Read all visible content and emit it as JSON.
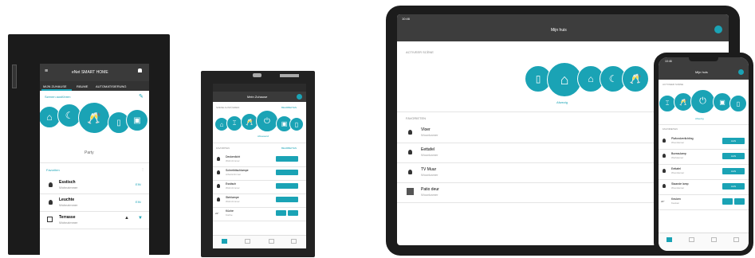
{
  "device1": {
    "app_title": "eNet SMART HOME",
    "tabs": [
      "MIJN ZUHAUSE",
      "RÄUME",
      "AUTOMATISIERUNG"
    ],
    "section_label": "Szenen ausführen",
    "active_scene": "Party",
    "favorites_label": "Favoriten",
    "items": [
      {
        "name": "Esstisch",
        "room": "Wohnzimmer",
        "action": "EIN"
      },
      {
        "name": "Leuchte",
        "room": "Wohnzimmer",
        "action": "EIN"
      },
      {
        "name": "Terrasse",
        "room": "Wohnzimmer",
        "action": ""
      }
    ]
  },
  "device2": {
    "app_title": "Mein Zuhause",
    "section_label": "SZENE AUSFÜHREN",
    "edit_label": "BEARBEITEN",
    "active_scene": "Abwesend",
    "favorites_label": "FAVORITEN",
    "items": [
      {
        "name": "Deckenlicht",
        "room": "Wohnzimmer"
      },
      {
        "name": "Schreibtischlampe",
        "room": "Arbeitszimmer"
      },
      {
        "name": "Esstisch",
        "room": "Wohnzimmer"
      },
      {
        "name": "Stehlampe",
        "room": "Wohnzimmer"
      },
      {
        "name": "Küche",
        "room": "Küche"
      }
    ]
  },
  "tablet": {
    "time": "10:46",
    "app_title": "Mijn huis",
    "section_label": "ACTIVEER SCÈNE",
    "active_scene": "Afwezig",
    "favorites_label": "FAVORIETEN",
    "items": [
      {
        "name": "Vloer",
        "room": "Woonkamer"
      },
      {
        "name": "Eettafel",
        "room": "Woonkamer"
      },
      {
        "name": "TV Muur",
        "room": "Woonkamer"
      },
      {
        "name": "Patio deur",
        "room": "Woonkamer"
      }
    ]
  },
  "phone": {
    "time": "10:46",
    "app_title": "Mijn huis",
    "section_label": "ACTIVEER SCÈNE",
    "active_scene": "Afwezig",
    "favorites_label": "FAVORIETEN",
    "items": [
      {
        "name": "Plafondverlichting",
        "room": "Woonkamer",
        "action": "AAN"
      },
      {
        "name": "Bureaulamp",
        "room": "Werkkamer",
        "action": "AAN"
      },
      {
        "name": "Eettafel",
        "room": "Woonkamer",
        "action": "AAN"
      },
      {
        "name": "Staande lamp",
        "room": "Woonkamer",
        "action": "AAN"
      },
      {
        "name": "Keuken",
        "room": "Keuken",
        "action": ""
      }
    ]
  },
  "colors": {
    "accent": "#1aa3b5",
    "device": "#1b1b1b",
    "bar": "#3a3a3a"
  }
}
